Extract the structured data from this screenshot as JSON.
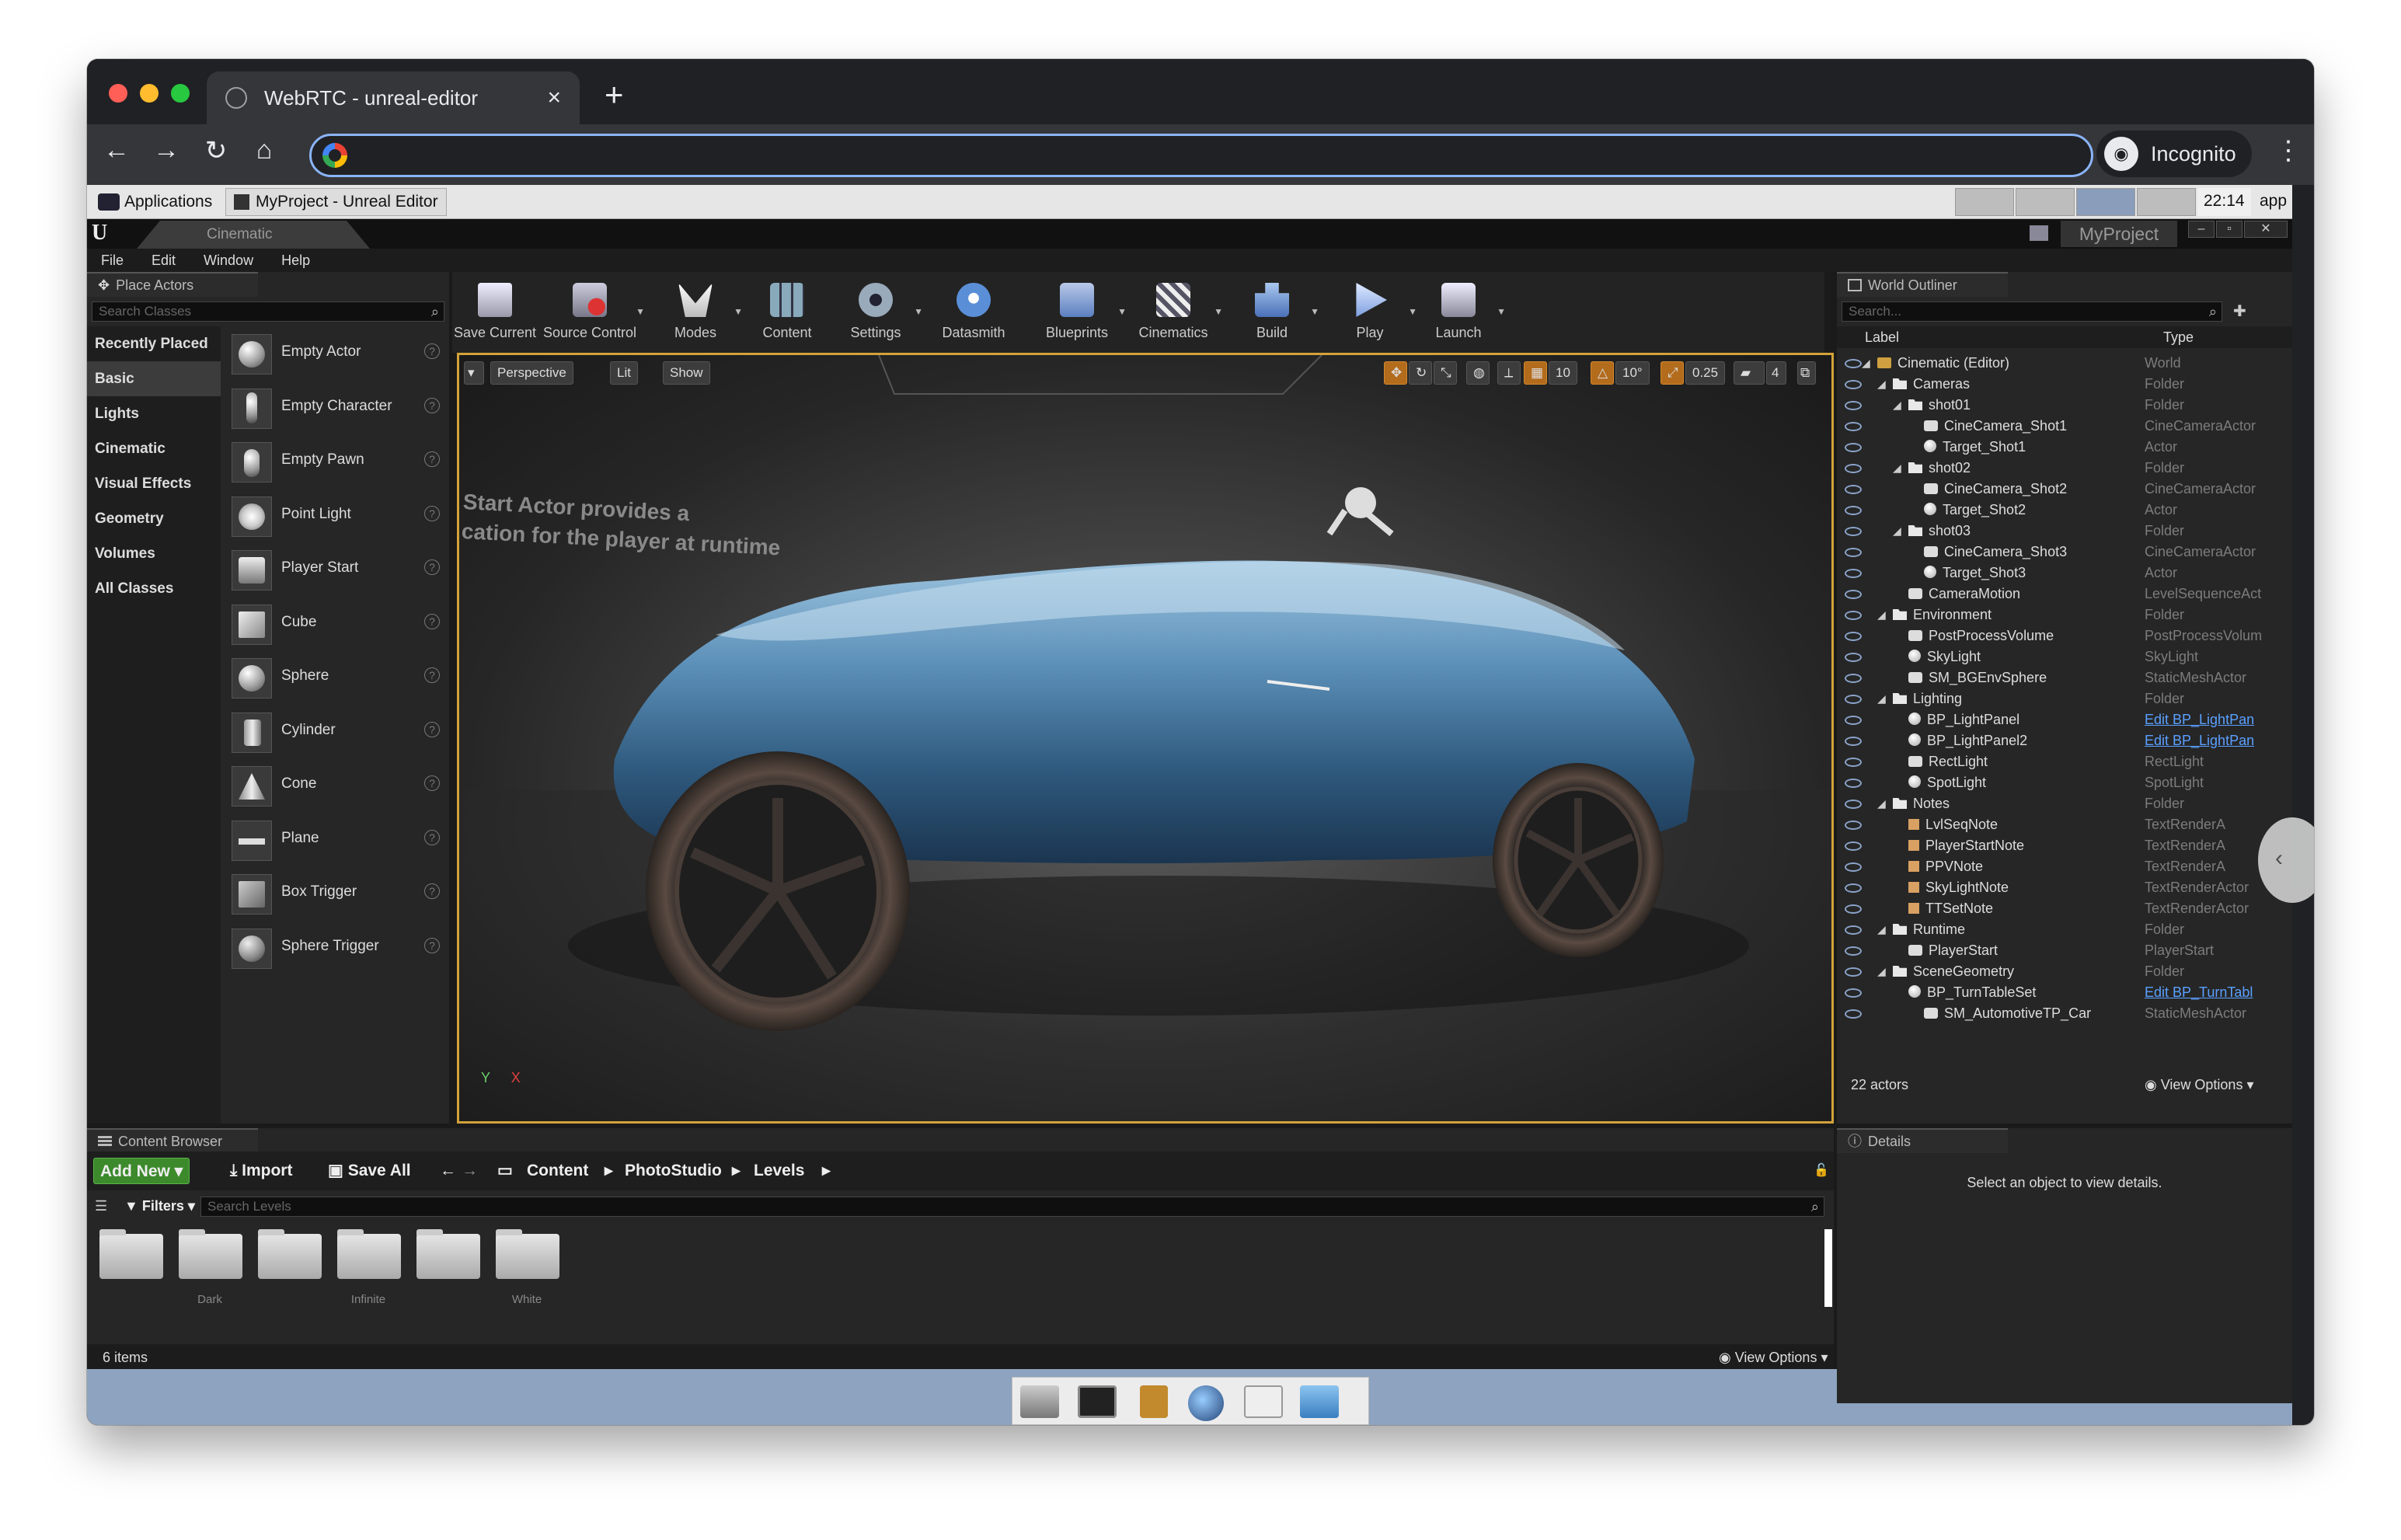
{
  "browser": {
    "tab_title": "WebRTC - unreal-editor",
    "close_glyph": "×",
    "new_tab_glyph": "+",
    "incognito_label": "Incognito",
    "url": ""
  },
  "vnc": {
    "applications_label": "Applications",
    "window_label": "MyProject - Unreal Editor",
    "clock": "22:14",
    "app_label": "app"
  },
  "ue": {
    "level_tab": "Cinematic",
    "project_name": "MyProject",
    "menu": [
      "File",
      "Edit",
      "Window",
      "Help"
    ]
  },
  "place_actors": {
    "tab_label": "Place Actors",
    "search_placeholder": "Search Classes",
    "categories": [
      "Recently Placed",
      "Basic",
      "Lights",
      "Cinematic",
      "Visual Effects",
      "Geometry",
      "Volumes",
      "All Classes"
    ],
    "selected_category": "Basic",
    "items": [
      "Empty Actor",
      "Empty Character",
      "Empty Pawn",
      "Point Light",
      "Player Start",
      "Cube",
      "Sphere",
      "Cylinder",
      "Cone",
      "Plane",
      "Box Trigger",
      "Sphere Trigger"
    ]
  },
  "toolbar": {
    "buttons": [
      "Save Current",
      "Source Control",
      "Modes",
      "Content",
      "Settings",
      "Datasmith",
      "Blueprints",
      "Cinematics",
      "Build",
      "Play",
      "Launch"
    ]
  },
  "viewport": {
    "perspective": "Perspective",
    "lit": "Lit",
    "show": "Show",
    "grid_value": "10",
    "rotation_value": "10°",
    "scale_value": "0.25",
    "camera_speed": "4",
    "note_line1": "Start Actor provides a",
    "note_line2": "cation for the player at runtime",
    "axis_y": "Y",
    "axis_x": "X"
  },
  "world_outliner": {
    "tab_label": "World Outliner",
    "search_placeholder": "Search...",
    "col_label": "Label",
    "col_type": "Type",
    "rows": [
      {
        "label": "Cinematic (Editor)",
        "type": "World",
        "depth": 0,
        "icon": "lvl",
        "link": false
      },
      {
        "label": "Cameras",
        "type": "Folder",
        "depth": 1,
        "icon": "fold",
        "link": false
      },
      {
        "label": "shot01",
        "type": "Folder",
        "depth": 2,
        "icon": "fold",
        "link": false
      },
      {
        "label": "CineCamera_Shot1",
        "type": "CineCameraActor",
        "depth": 3,
        "icon": "cam",
        "link": false
      },
      {
        "label": "Target_Shot1",
        "type": "Actor",
        "depth": 3,
        "icon": "ball",
        "link": false
      },
      {
        "label": "shot02",
        "type": "Folder",
        "depth": 2,
        "icon": "fold",
        "link": false
      },
      {
        "label": "CineCamera_Shot2",
        "type": "CineCameraActor",
        "depth": 3,
        "icon": "cam",
        "link": false
      },
      {
        "label": "Target_Shot2",
        "type": "Actor",
        "depth": 3,
        "icon": "ball",
        "link": false
      },
      {
        "label": "shot03",
        "type": "Folder",
        "depth": 2,
        "icon": "fold",
        "link": false
      },
      {
        "label": "CineCamera_Shot3",
        "type": "CineCameraActor",
        "depth": 3,
        "icon": "cam",
        "link": false
      },
      {
        "label": "Target_Shot3",
        "type": "Actor",
        "depth": 3,
        "icon": "ball",
        "link": false
      },
      {
        "label": "CameraMotion",
        "type": "LevelSequenceActo",
        "depth": 2,
        "icon": "cam",
        "link": false
      },
      {
        "label": "Environment",
        "type": "Folder",
        "depth": 1,
        "icon": "fold",
        "link": false
      },
      {
        "label": "PostProcessVolume",
        "type": "PostProcessVolum",
        "depth": 2,
        "icon": "cam",
        "link": false
      },
      {
        "label": "SkyLight",
        "type": "SkyLight",
        "depth": 2,
        "icon": "ball",
        "link": false
      },
      {
        "label": "SM_BGEnvSphere",
        "type": "StaticMeshActor",
        "depth": 2,
        "icon": "cam",
        "link": false
      },
      {
        "label": "Lighting",
        "type": "Folder",
        "depth": 1,
        "icon": "fold",
        "link": false
      },
      {
        "label": "BP_LightPanel",
        "type": "Edit BP_LightPan",
        "depth": 2,
        "icon": "ball",
        "link": true
      },
      {
        "label": "BP_LightPanel2",
        "type": "Edit BP_LightPan",
        "depth": 2,
        "icon": "ball",
        "link": true
      },
      {
        "label": "RectLight",
        "type": "RectLight",
        "depth": 2,
        "icon": "cam",
        "link": false
      },
      {
        "label": "SpotLight",
        "type": "SpotLight",
        "depth": 2,
        "icon": "ball",
        "link": false
      },
      {
        "label": "Notes",
        "type": "Folder",
        "depth": 1,
        "icon": "fold",
        "link": false
      },
      {
        "label": "LvlSeqNote",
        "type": "TextRenderA",
        "depth": 2,
        "icon": "txt",
        "link": false
      },
      {
        "label": "PlayerStartNote",
        "type": "TextRenderA",
        "depth": 2,
        "icon": "txt",
        "link": false
      },
      {
        "label": "PPVNote",
        "type": "TextRenderA",
        "depth": 2,
        "icon": "txt",
        "link": false
      },
      {
        "label": "SkyLightNote",
        "type": "TextRenderActor",
        "depth": 2,
        "icon": "txt",
        "link": false
      },
      {
        "label": "TTSetNote",
        "type": "TextRenderActor",
        "depth": 2,
        "icon": "txt",
        "link": false
      },
      {
        "label": "Runtime",
        "type": "Folder",
        "depth": 1,
        "icon": "fold",
        "link": false
      },
      {
        "label": "PlayerStart",
        "type": "PlayerStart",
        "depth": 2,
        "icon": "cam",
        "link": false
      },
      {
        "label": "SceneGeometry",
        "type": "Folder",
        "depth": 1,
        "icon": "fold",
        "link": false
      },
      {
        "label": "BP_TurnTableSet",
        "type": "Edit BP_TurnTabl",
        "depth": 2,
        "icon": "ball",
        "link": true
      },
      {
        "label": "SM_AutomotiveTP_Car",
        "type": "StaticMeshActor",
        "depth": 3,
        "icon": "cam",
        "link": false
      }
    ],
    "actor_count": "22 actors",
    "view_options": "View Options"
  },
  "details": {
    "tab_label": "Details",
    "empty_message": "Select an object to view details."
  },
  "content_browser": {
    "tab_label": "Content Browser",
    "add_new": "Add New",
    "import": "Import",
    "save_all": "Save All",
    "path": [
      "Content",
      "PhotoStudio",
      "Levels"
    ],
    "filters": "Filters",
    "search_placeholder": "Search Levels",
    "folder_labels": [
      "",
      "Dark",
      "",
      "Infinite",
      "",
      "White"
    ],
    "item_count": "6 items",
    "view_options": "View Options"
  },
  "colors": {
    "viewport_border": "#d3a23a",
    "add_new_green": "#3c8a2c",
    "link_blue": "#5aa0ff",
    "omnibox_focus": "#8ab4f8"
  }
}
